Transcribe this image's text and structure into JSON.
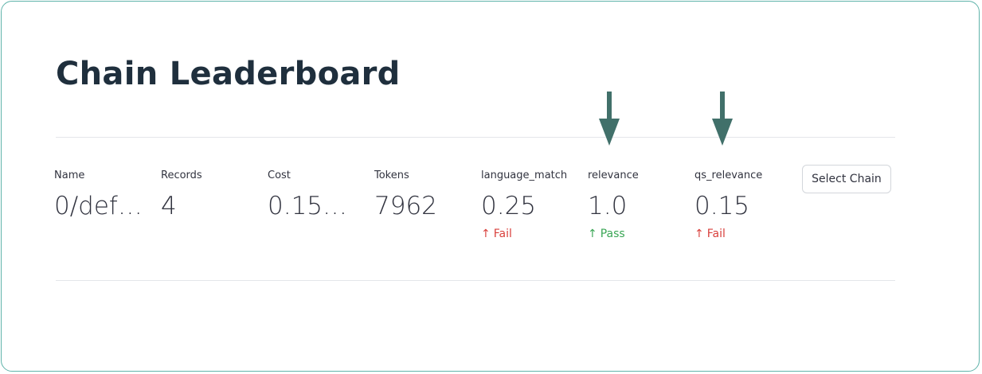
{
  "page": {
    "title": "Chain Leaderboard"
  },
  "metrics": [
    {
      "label": "Name",
      "value": "0/def…"
    },
    {
      "label": "Records",
      "value": "4"
    },
    {
      "label": "Cost",
      "value": "0.15…"
    },
    {
      "label": "Tokens",
      "value": "7962"
    },
    {
      "label": "language_match",
      "value": "0.25",
      "delta": "Fail",
      "status": "fail"
    },
    {
      "label": "relevance",
      "value": "1.0",
      "delta": "Pass",
      "status": "pass"
    },
    {
      "label": "qs_relevance",
      "value": "0.15",
      "delta": "Fail",
      "status": "fail"
    }
  ],
  "actions": {
    "select_chain_label": "Select Chain"
  },
  "icons": {
    "delta_arrow": "arrow-up-icon",
    "annotation": "arrow-down-icon"
  },
  "colors": {
    "frame_border": "#5fb3aa",
    "title": "#1f2f3d",
    "fail": "#d9413d",
    "pass": "#3aa655",
    "annotation_arrow": "#41706a"
  }
}
